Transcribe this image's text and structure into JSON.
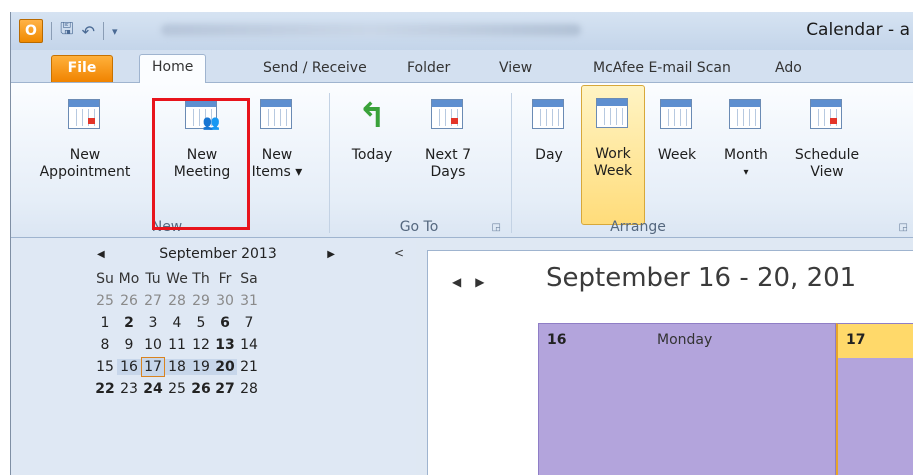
{
  "window": {
    "title": "Calendar - a"
  },
  "qat": {
    "app_icon": "O"
  },
  "tabs": [
    "File",
    "Home",
    "Send / Receive",
    "Folder",
    "View",
    "McAfee E-mail Scan",
    "Ado"
  ],
  "ribbon": {
    "groups": {
      "new": {
        "label": "New",
        "buttons": [
          {
            "line1": "New",
            "line2": "Appointment"
          },
          {
            "line1": "New",
            "line2": "Meeting"
          },
          {
            "line1": "New",
            "line2": "Items ▾"
          }
        ]
      },
      "goto": {
        "label": "Go To",
        "buttons": [
          {
            "line1": "Today",
            "line2": ""
          },
          {
            "line1": "Next 7",
            "line2": "Days"
          }
        ]
      },
      "arrange": {
        "label": "Arrange",
        "buttons": [
          {
            "line1": "Day",
            "line2": ""
          },
          {
            "line1": "Work",
            "line2": "Week"
          },
          {
            "line1": "Week",
            "line2": ""
          },
          {
            "line1": "Month",
            "line2": "▾"
          },
          {
            "line1": "Schedule",
            "line2": "View"
          }
        ]
      }
    }
  },
  "mini_calendar": {
    "title": "September 2013",
    "weekdays": [
      "Su",
      "Mo",
      "Tu",
      "We",
      "Th",
      "Fr",
      "Sa"
    ],
    "weeks": [
      [
        "25",
        "26",
        "27",
        "28",
        "29",
        "30",
        "31"
      ],
      [
        "1",
        "2",
        "3",
        "4",
        "5",
        "6",
        "7"
      ],
      [
        "8",
        "9",
        "10",
        "11",
        "12",
        "13",
        "14"
      ],
      [
        "15",
        "16",
        "17",
        "18",
        "19",
        "20",
        "21"
      ],
      [
        "22",
        "23",
        "24",
        "25",
        "26",
        "27",
        "28"
      ]
    ]
  },
  "main": {
    "title": "September 16 - 20, 201",
    "days": [
      {
        "num": "16",
        "name": "Monday"
      },
      {
        "num": "17",
        "name": ""
      }
    ]
  },
  "colors": {
    "accent_orange": "#f08300",
    "highlight_red": "#e8141c",
    "day_purple": "#b3a4dc"
  }
}
